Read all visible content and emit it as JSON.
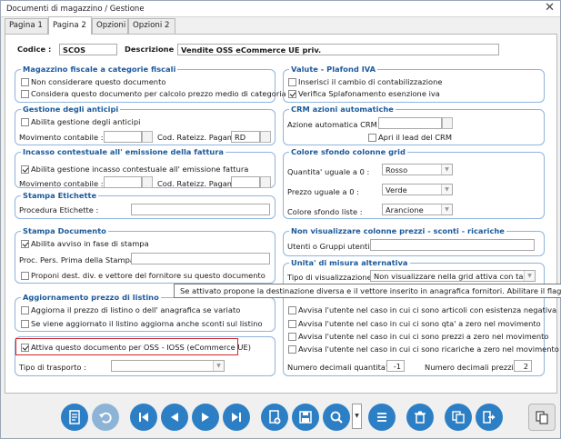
{
  "window": {
    "title": "Documenti di magazzino / Gestione",
    "close": "✕"
  },
  "tabs": [
    "Pagina 1",
    "Pagina 2",
    "Opzioni",
    "Opzioni 2"
  ],
  "header": {
    "codice_label": "Codice :",
    "codice_value": "SCOS",
    "descrizione_label": "Descrizione :",
    "descrizione_value": "Vendite OSS eCommerce UE priv."
  },
  "magazzino": {
    "title": "Magazzino fiscale a categorie fiscali",
    "opt1": "Non considerare questo documento",
    "opt2": "Considera questo documento per calcolo prezzo medio di categoria"
  },
  "anticipi": {
    "title": "Gestione degli anticipi",
    "opt1": "Abilita gestione degli anticipi",
    "movimento_label": "Movimento contabile :",
    "rateizz_label": "Cod. Rateizz. Pagam.:",
    "rateizz_value": "RD"
  },
  "incasso": {
    "title": "Incasso contestuale all' emissione della fattura",
    "opt1": "Abilita gestione incasso contestuale all' emissione fattura",
    "movimento_label": "Movimento contabile :",
    "rateizz_label": "Cod. Rateizz. Pagam.:"
  },
  "etichette": {
    "title": "Stampa Etichette",
    "procedura_label": "Procedura Etichette :"
  },
  "stampa": {
    "title": "Stampa Documento",
    "opt1": "Abilita avviso in fase di stampa",
    "proc_label": "Proc. Pers. Prima della Stampa :",
    "opt2": "Proponi dest. div. e vettore del fornitore su questo documento"
  },
  "listino": {
    "title": "Aggiornamento prezzo di listino",
    "opt1": "Aggiorna il prezzo di listino o dell' anagrafica se variato",
    "opt2": "Se viene aggiornato il listino aggiorna anche sconti sul listino"
  },
  "oss": {
    "opt1": "Attiva questo documento per  OSS - IOSS (eCommerce UE)"
  },
  "trasporto": {
    "label": "Tipo di trasporto :"
  },
  "valute": {
    "title": "Valute - Plafond IVA",
    "opt1": "Inserisci il cambio di contabilizzazione",
    "opt2": "Verifica Splafonamento esenzione iva"
  },
  "crm": {
    "title": "CRM azioni automatiche",
    "azione_label": "Azione automatica CRM :",
    "opt1": "Apri il lead del CRM"
  },
  "colore": {
    "title": "Colore sfondo colonne grid",
    "q_label": "Quantita' uguale a 0 :",
    "q_value": "Rosso",
    "p_label": "Prezzo uguale a 0 :",
    "p_value": "Verde",
    "l_label": "Colore sfondo liste :",
    "l_value": "Arancione"
  },
  "nonvis": {
    "title": "Non visualizzare colonne prezzi - sconti - ricariche",
    "utenti_label": "Utenti o Gruppi utenti :"
  },
  "unita": {
    "title": "Unita' di misura alternativa",
    "tipo_label": "Tipo di visualizzazione :",
    "tipo_value": "Non visualizzare nella grid attiva con tasto d"
  },
  "tooltip": "Se attivato propone la destinazione diversa e il vettore inserito in anagrafica fornitori. Abilitare il flag nei docum",
  "avvisi": {
    "opt1": "Avvisa l'utente nel caso in cui ci sono articoli con esistenza negativa",
    "opt2": "Avvisa l'utente nel caso in cui ci sono qta' a zero nel movimento",
    "opt3": "Avvisa l'utente nel caso in cui ci sono prezzi a zero nel movimento",
    "opt4": "Avvisa l'utente nel caso in cui ci sono ricariche a zero nel movimento"
  },
  "decimali": {
    "q_label": "Numero decimali quantita' :",
    "q_value": "-1",
    "p_label": "Numero decimali prezzi :",
    "p_value": "2"
  },
  "colors": {
    "accent": "#2d7fc5",
    "group_border": "#8fb4dc",
    "group_title": "#1c5a9c",
    "highlight": "#d12727"
  }
}
